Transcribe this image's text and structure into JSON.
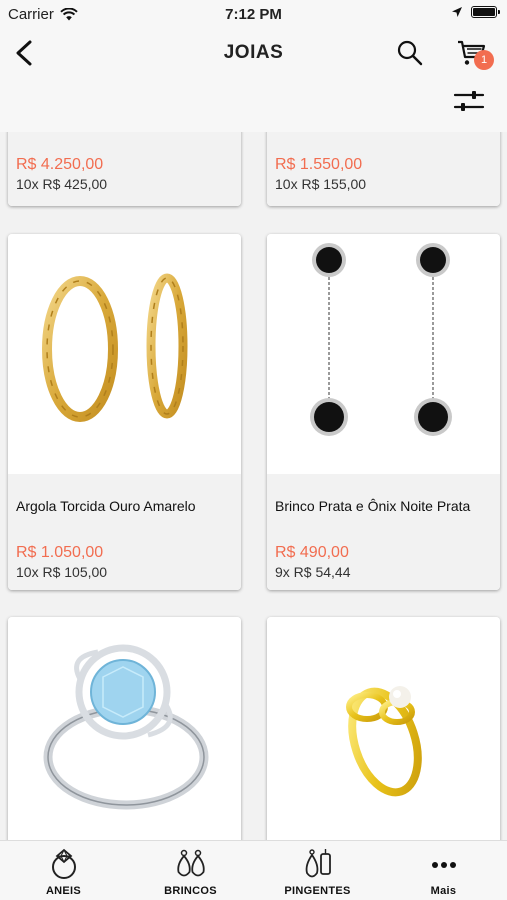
{
  "status_bar": {
    "carrier": "Carrier",
    "time": "7:12 PM"
  },
  "nav": {
    "title": "JOIAS",
    "filter_badge": "1"
  },
  "products": [
    {
      "name": "",
      "price": "R$ 4.250,00",
      "installments": "10x R$ 425,00"
    },
    {
      "name": "",
      "price": "R$ 1.550,00",
      "installments": "10x R$ 155,00"
    },
    {
      "name": "Argola Torcida Ouro Amarelo",
      "price": "R$ 1.050,00",
      "installments": "10x R$ 105,00"
    },
    {
      "name": "Brinco Prata e Ônix Noite Prata",
      "price": "R$ 490,00",
      "installments": "9x R$ 54,44"
    },
    {
      "name": "",
      "price": "",
      "installments": ""
    },
    {
      "name": "",
      "price": "",
      "installments": ""
    }
  ],
  "tabs": [
    {
      "label": "ANEIS",
      "icon": "ring-icon"
    },
    {
      "label": "BRINCOS",
      "icon": "earrings-icon"
    },
    {
      "label": "PINGENTES",
      "icon": "pendants-icon"
    },
    {
      "label": "Mais",
      "icon": "more-icon"
    }
  ],
  "colors": {
    "price": "#f26d50",
    "badge": "#f26d50",
    "background": "#f2f2f2"
  }
}
